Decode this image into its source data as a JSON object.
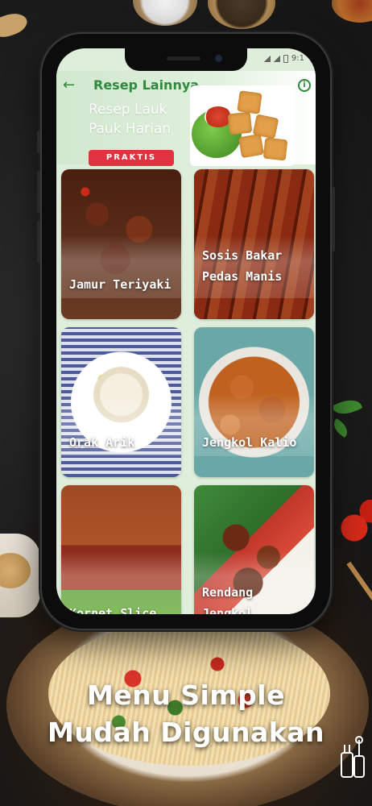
{
  "app": {
    "title": "Resep Lainnya",
    "status_time": "9:1"
  },
  "banner": {
    "line1": "Resep Lauk",
    "line2": "Pauk Harian",
    "badge": "PRAKTIS"
  },
  "recipes": [
    {
      "name_line1": "Jamur Teriyaki",
      "name_line2": ""
    },
    {
      "name_line1": "Sosis Bakar",
      "name_line2": "Pedas Manis"
    },
    {
      "name_line1": "Orak Arik",
      "name_line2": ""
    },
    {
      "name_line1": "Jengkol Kalio",
      "name_line2": ""
    },
    {
      "name_line1": "Kornet Slice",
      "name_line2": ""
    },
    {
      "name_line1": "Rendang",
      "name_line2": "Jengkol"
    }
  ],
  "promo": {
    "line1": "Menu Simple",
    "line2": "Mudah Digunakan"
  },
  "colors": {
    "accent_green": "#2f8a3c",
    "badge_red": "#e0333f"
  },
  "icons": {
    "back": "arrow-left-icon",
    "info": "info-icon",
    "utensils": "kitchen-utensils-icon"
  }
}
